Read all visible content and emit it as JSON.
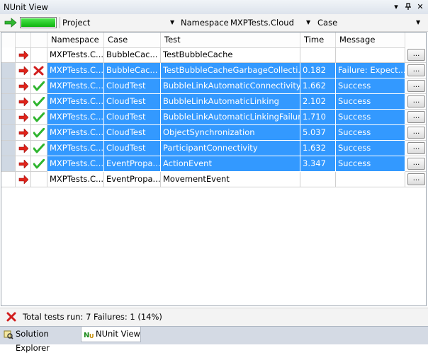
{
  "window": {
    "title": "NUnit View"
  },
  "toolbar": {
    "progress_fraction": 1.0,
    "project_label": "Project",
    "namespace_label": "Namespace",
    "namespace_value": "MXPTests.Cloud",
    "case_label": "Case"
  },
  "grid": {
    "columns": [
      "Namespace",
      "Case",
      "Test",
      "Time",
      "Message"
    ],
    "rows": [
      {
        "status": "none",
        "selected": false,
        "namespace": "MXPTests.C...",
        "case": "BubbleCac...",
        "test": "TestBubbleCache",
        "time": "",
        "message": "",
        "button": "..."
      },
      {
        "status": "fail",
        "selected": true,
        "namespace": "MXPTests.C...",
        "case": "BubbleCac...",
        "test": "TestBubbleCacheGarbageCollecti...",
        "time": "0.182",
        "message": "Failure:   Expect...",
        "button": "..."
      },
      {
        "status": "pass",
        "selected": true,
        "namespace": "MXPTests.C...",
        "case": "CloudTest",
        "test": "BubbleLinkAutomaticConnectivity",
        "time": "1.662",
        "message": "Success",
        "button": "..."
      },
      {
        "status": "pass",
        "selected": true,
        "namespace": "MXPTests.C...",
        "case": "CloudTest",
        "test": "BubbleLinkAutomaticLinking",
        "time": "2.102",
        "message": "Success",
        "button": "..."
      },
      {
        "status": "pass",
        "selected": true,
        "namespace": "MXPTests.C...",
        "case": "CloudTest",
        "test": "BubbleLinkAutomaticLinkingFailure",
        "time": "1.710",
        "message": "Success",
        "button": "..."
      },
      {
        "status": "pass",
        "selected": true,
        "namespace": "MXPTests.C...",
        "case": "CloudTest",
        "test": "ObjectSynchronization",
        "time": "5.037",
        "message": "Success",
        "button": "..."
      },
      {
        "status": "pass",
        "selected": true,
        "namespace": "MXPTests.C...",
        "case": "CloudTest",
        "test": "ParticipantConnectivity",
        "time": "1.632",
        "message": "Success",
        "button": "..."
      },
      {
        "status": "pass",
        "selected": true,
        "namespace": "MXPTests.C...",
        "case": "EventPropa...",
        "test": "ActionEvent",
        "time": "3.347",
        "message": "Success",
        "button": "..."
      },
      {
        "status": "none",
        "selected": false,
        "namespace": "MXPTests.C...",
        "case": "EventPropa...",
        "test": "MovementEvent",
        "time": "",
        "message": "",
        "button": "..."
      }
    ]
  },
  "status_bar": {
    "text": "Total tests run: 7 Failures: 1 (14%)"
  },
  "tabs": [
    {
      "label": "Solution Explorer",
      "active": false,
      "icon": "solution-explorer-icon"
    },
    {
      "label": "NUnit View",
      "active": true,
      "icon": "nunit-icon"
    }
  ],
  "colors": {
    "selection": "#3399ff",
    "pass": "#2fb52f",
    "fail": "#d21e1e",
    "arrow": "#e0241b"
  }
}
